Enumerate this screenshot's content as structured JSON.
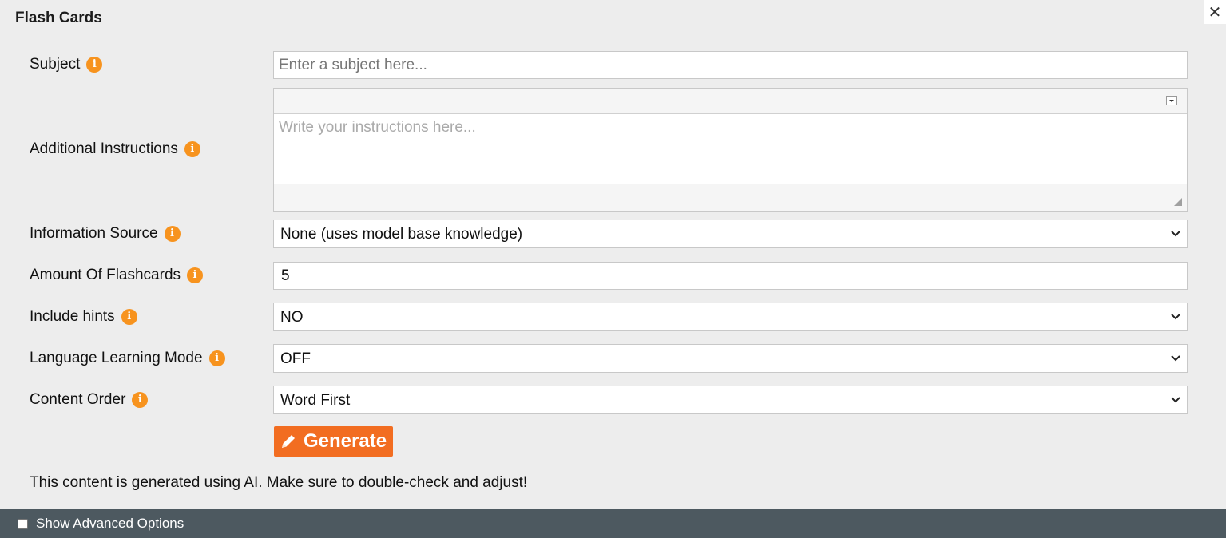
{
  "dialog": {
    "title": "Flash Cards",
    "close_glyph": "✕"
  },
  "form": {
    "subject": {
      "label": "Subject",
      "value": "",
      "placeholder": "Enter a subject here..."
    },
    "additional_instructions": {
      "label": "Additional Instructions",
      "value": "",
      "placeholder": "Write your instructions here..."
    },
    "information_source": {
      "label": "Information Source",
      "selected": "None (uses model base knowledge)"
    },
    "amount_of_flashcards": {
      "label": "Amount Of Flashcards",
      "value": "5"
    },
    "include_hints": {
      "label": "Include hints",
      "selected": "NO"
    },
    "language_learning_mode": {
      "label": "Language Learning Mode",
      "selected": "OFF"
    },
    "content_order": {
      "label": "Content Order",
      "selected": "Word First"
    }
  },
  "actions": {
    "generate_label": "Generate"
  },
  "disclaimer": "This content is generated using AI. Make sure to double-check and adjust!",
  "footer": {
    "advanced_label": "Show Advanced Options",
    "advanced_checked": false
  },
  "icons": {
    "info": "i"
  },
  "colors": {
    "accent": "#f26d21",
    "info_icon": "#f7931e",
    "footer_bg": "#4d5960"
  }
}
